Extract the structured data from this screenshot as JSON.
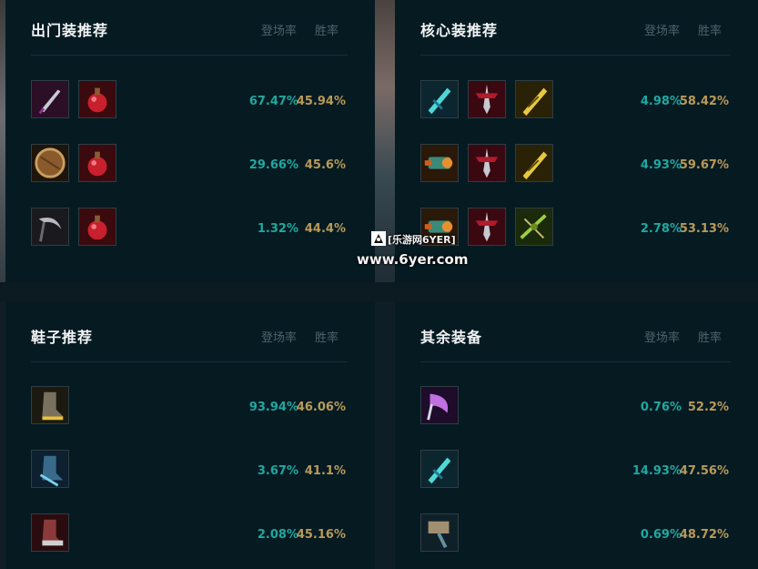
{
  "columns": {
    "pick_rate": "登场率",
    "win_rate": "胜率"
  },
  "colors": {
    "pick_rate": "#1fa8a0",
    "win_rate": "#b89a58",
    "panel_bg": "#061a22"
  },
  "starter": {
    "title": "出门装推荐",
    "rows": [
      {
        "items": [
          "dagger-icon",
          "health-potion-icon"
        ],
        "pick": "67.47%",
        "win": "45.94%"
      },
      {
        "items": [
          "wooden-shield-icon",
          "health-potion-icon"
        ],
        "pick": "29.66%",
        "win": "45.6%"
      },
      {
        "items": [
          "scythe-icon",
          "health-potion-icon"
        ],
        "pick": "1.32%",
        "win": "44.4%"
      }
    ]
  },
  "core": {
    "title": "核心装推荐",
    "rows": [
      {
        "items": [
          "frost-blade-icon",
          "red-crossblade-icon",
          "golden-sword-icon"
        ],
        "pick": "4.98%",
        "win": "58.42%"
      },
      {
        "items": [
          "arm-cannon-icon",
          "red-crossblade-icon",
          "golden-sword-icon"
        ],
        "pick": "4.93%",
        "win": "59.67%"
      },
      {
        "items": [
          "arm-cannon-icon",
          "red-crossblade-icon",
          "green-crossbow-icon"
        ],
        "pick": "2.78%",
        "win": "53.13%"
      }
    ]
  },
  "boots": {
    "title": "鞋子推荐",
    "rows": [
      {
        "items": [
          "golden-greaves-icon"
        ],
        "pick": "93.94%",
        "win": "46.06%"
      },
      {
        "items": [
          "blue-boots-icon"
        ],
        "pick": "3.67%",
        "win": "41.1%"
      },
      {
        "items": [
          "red-boots-icon"
        ],
        "pick": "2.08%",
        "win": "45.16%"
      }
    ]
  },
  "other": {
    "title": "其余装备",
    "rows": [
      {
        "items": [
          "violet-axe-icon"
        ],
        "pick": "0.76%",
        "win": "52.2%"
      },
      {
        "items": [
          "frost-blade-icon"
        ],
        "pick": "14.93%",
        "win": "47.56%"
      },
      {
        "items": [
          "stone-hammer-icon"
        ],
        "pick": "0.69%",
        "win": "48.72%"
      }
    ]
  },
  "watermark": {
    "brand": "[乐游网6YER]",
    "url": "www.6yer.com"
  }
}
